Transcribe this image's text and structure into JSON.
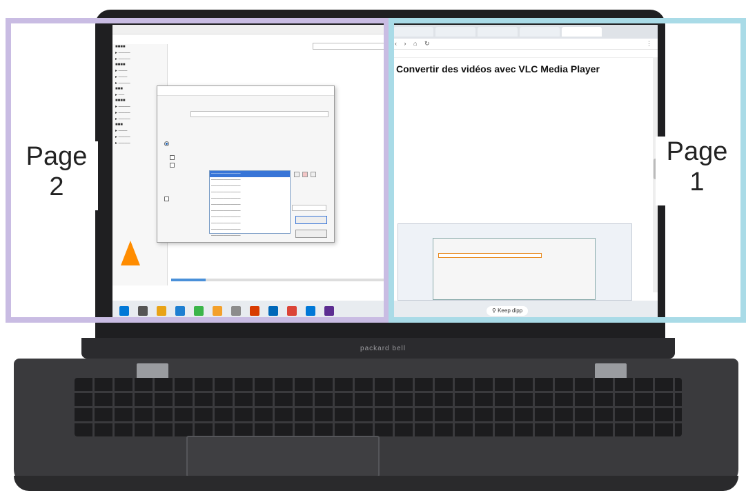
{
  "overlays": {
    "left_label_line1": "Page",
    "left_label_line2": "2",
    "right_label_line1": "Page",
    "right_label_line2": "1",
    "left_color": "#c9bce3",
    "right_color": "#a9dbe7"
  },
  "laptop": {
    "brand": "packard bell"
  },
  "browser": {
    "article_title": "Convertir des vidéos avec VLC Media Player",
    "scroll_position": 0.47
  },
  "taskbar": {
    "search_text": "Keep dipp",
    "icons": [
      "start-icon",
      "task-view-icon",
      "file-explorer-icon",
      "store-icon",
      "edge-icon",
      "app-icon",
      "app-icon",
      "vlc-icon",
      "outlook-icon",
      "chrome-icon",
      "mail-icon",
      "app-icon"
    ]
  },
  "vlc": {
    "progress": 0.16,
    "profile_options_count": 11,
    "selected_profile_index": 0
  }
}
